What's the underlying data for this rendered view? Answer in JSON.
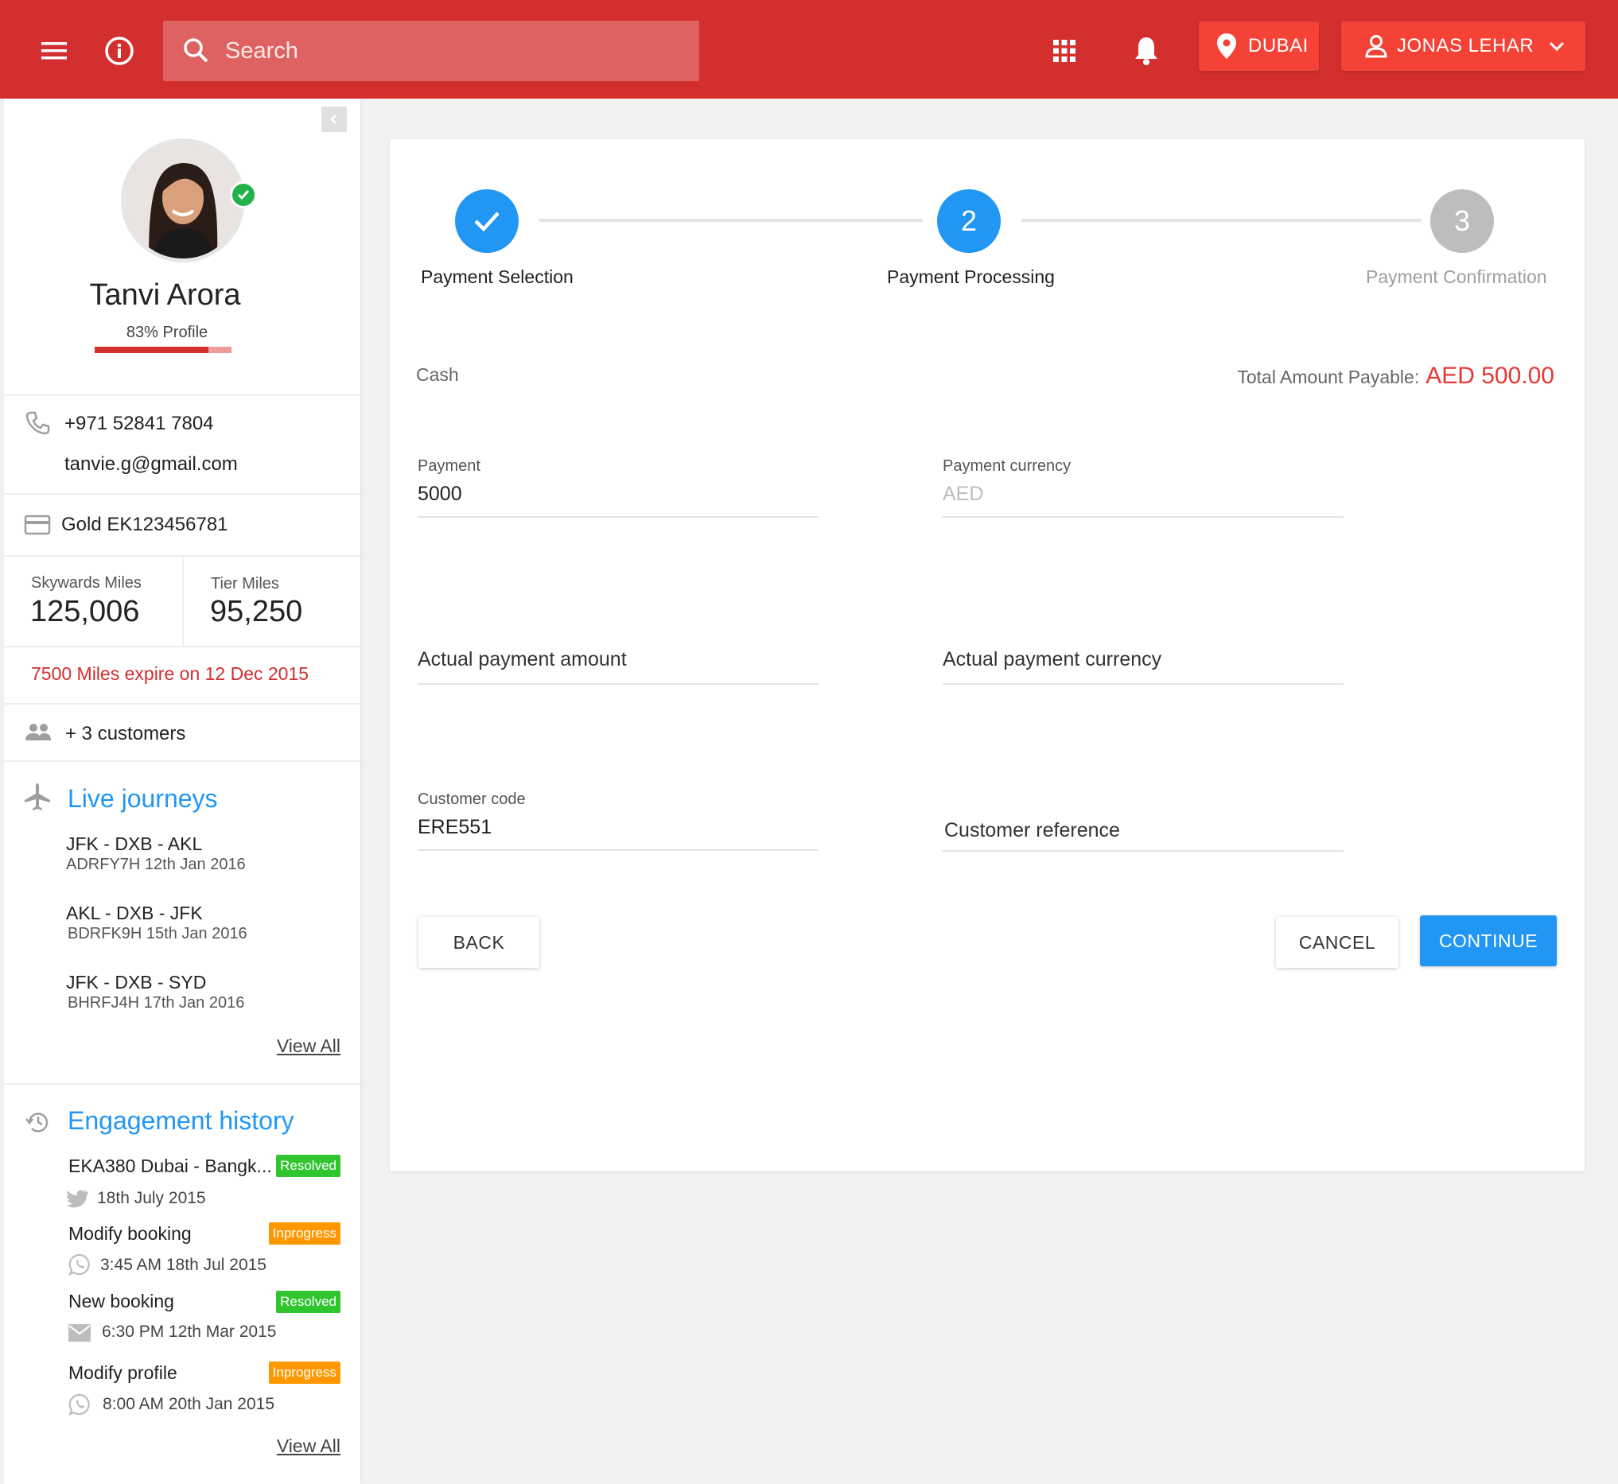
{
  "header": {
    "search_placeholder": "Search",
    "location": "DUBAI",
    "user": "JONAS LEHAR"
  },
  "profile": {
    "name": "Tanvi Arora",
    "profile_completion_label": "83% Profile",
    "profile_completion": 0.83,
    "phone": "+971 52841 7804",
    "email": "tanvie.g@gmail.com",
    "membership": "Gold EK123456781",
    "skywards_label": "Skywards Miles",
    "skywards_value": "125,006",
    "tier_label": "Tier Miles",
    "tier_value": "95,250",
    "expiry_notice": "7500 Miles expire on 12 Dec 2015",
    "related_customers": "+ 3  customers"
  },
  "live_journeys": {
    "title": "Live journeys",
    "items": [
      {
        "route": "JFK - DXB - AKL",
        "meta": "ADRFY7H   12th Jan 2016"
      },
      {
        "route": "AKL - DXB - JFK",
        "meta": "BDRFK9H   15th Jan 2016"
      },
      {
        "route": "JFK - DXB - SYD",
        "meta": "BHRFJ4H    17th Jan  2016"
      }
    ],
    "view_all": "View All"
  },
  "engagement_history": {
    "title": "Engagement history",
    "items": [
      {
        "title": "EKA380 Dubai - Bangk...",
        "status": "Resolved",
        "meta": "18th July 2015",
        "channel": "twitter-icon"
      },
      {
        "title": "Modify booking",
        "status": "Inprogress",
        "meta": "3:45 AM 18th Jul 2015",
        "channel": "whatsapp-icon"
      },
      {
        "title": "New booking",
        "status": "Resolved",
        "meta": "6:30 PM 12th Mar 2015",
        "channel": "mail-icon"
      },
      {
        "title": "Modify profile",
        "status": "Inprogress",
        "meta": "8:00 AM 20th Jan 2015",
        "channel": "whatsapp-icon"
      }
    ],
    "view_all": "View All"
  },
  "stepper": {
    "steps": [
      {
        "label": "Payment Selection",
        "state": "done"
      },
      {
        "label": "Payment Processing",
        "number": "2",
        "state": "active"
      },
      {
        "label": "Payment Confirmation",
        "number": "3",
        "state": "pending"
      }
    ]
  },
  "payment": {
    "method": "Cash",
    "total_label": "Total  Amount Payable:",
    "total_value": "AED 500.00",
    "payment_label": "Payment",
    "payment_value": "5000",
    "currency_label": "Payment currency",
    "currency_value": "AED",
    "actual_amount_placeholder": "Actual payment amount",
    "actual_currency_placeholder": "Actual payment currency",
    "customer_code_label": "Customer code",
    "customer_code_value": "ERE551",
    "customer_reference_placeholder": "Customer reference"
  },
  "actions": {
    "back": "BACK",
    "cancel": "CANCEL",
    "continue": "CONTINUE"
  },
  "colors": {
    "brand_red": "#d32f2f",
    "accent_blue": "#2196f3",
    "resolved_green": "#2fc52f",
    "inprogress_orange": "#ff9800"
  }
}
